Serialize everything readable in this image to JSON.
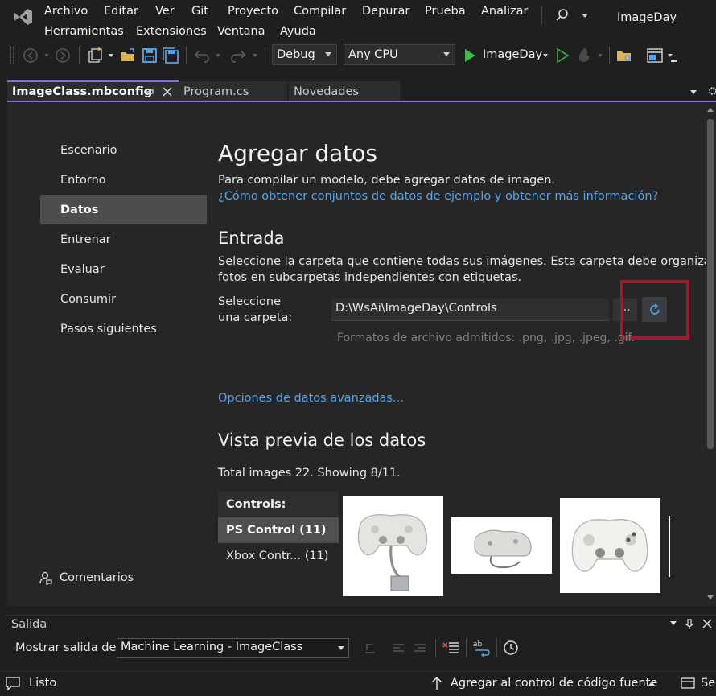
{
  "menu": {
    "row1": [
      "Archivo",
      "Editar",
      "Ver",
      "Git",
      "Proyecto",
      "Compilar",
      "Depurar",
      "Prueba",
      "Analizar"
    ],
    "row2": [
      "Herramientas",
      "Extensiones",
      "Ventana",
      "Ayuda"
    ],
    "app_title": "ImageDay"
  },
  "toolbar": {
    "config": "Debug",
    "platform": "Any CPU",
    "run_target": "ImageDay"
  },
  "tabs": [
    {
      "label": "ImageClass.mbconfig",
      "active": true
    },
    {
      "label": "Program.cs",
      "active": false
    },
    {
      "label": "Novedades",
      "active": false
    }
  ],
  "nav": {
    "items": [
      "Escenario",
      "Entorno",
      "Datos",
      "Entrenar",
      "Evaluar",
      "Consumir",
      "Pasos siguientes"
    ],
    "selected": "Datos",
    "feedback": "Comentarios"
  },
  "content": {
    "title": "Agregar datos",
    "intro": "Para compilar un modelo, debe agregar datos de imagen.",
    "intro_link": "¿Cómo obtener conjuntos de datos de ejemplo y obtener más información?",
    "input_heading": "Entrada",
    "input_desc1": "Seleccione la carpeta que contiene todas sus imágenes. Esta carpeta debe organizar",
    "input_desc2": "fotos en subcarpetas independientes con etiquetas.",
    "folder_label1": "Seleccione",
    "folder_label2": "una carpeta:",
    "folder_value": "D:\\WsAi\\ImageDay\\Controls",
    "browse_label": "...",
    "formats_hint": "Formatos de archivo admitidos: .png, .jpg, .jpeg, .gif.",
    "advanced_link": "Opciones de datos avanzadas...",
    "preview_heading": "Vista previa de los datos",
    "preview_summary": "Total images 22. Showing 8/11.",
    "list_header": "Controls:",
    "list_selected": "PS Control (11)",
    "list_other": "Xbox Contr... (11)"
  },
  "output_panel": {
    "title": "Salida",
    "show_label": "Mostrar salida de:",
    "source": "Machine Learning - ImageClass"
  },
  "status": {
    "ready": "Listo",
    "source_control": "Agregar al control de código fuente",
    "select": "Sel"
  },
  "colors": {
    "accent": "#8d6bd6",
    "link": "#5ba3e6",
    "highlight_box": "#9a1d2c",
    "run_green": "#3fb950"
  }
}
